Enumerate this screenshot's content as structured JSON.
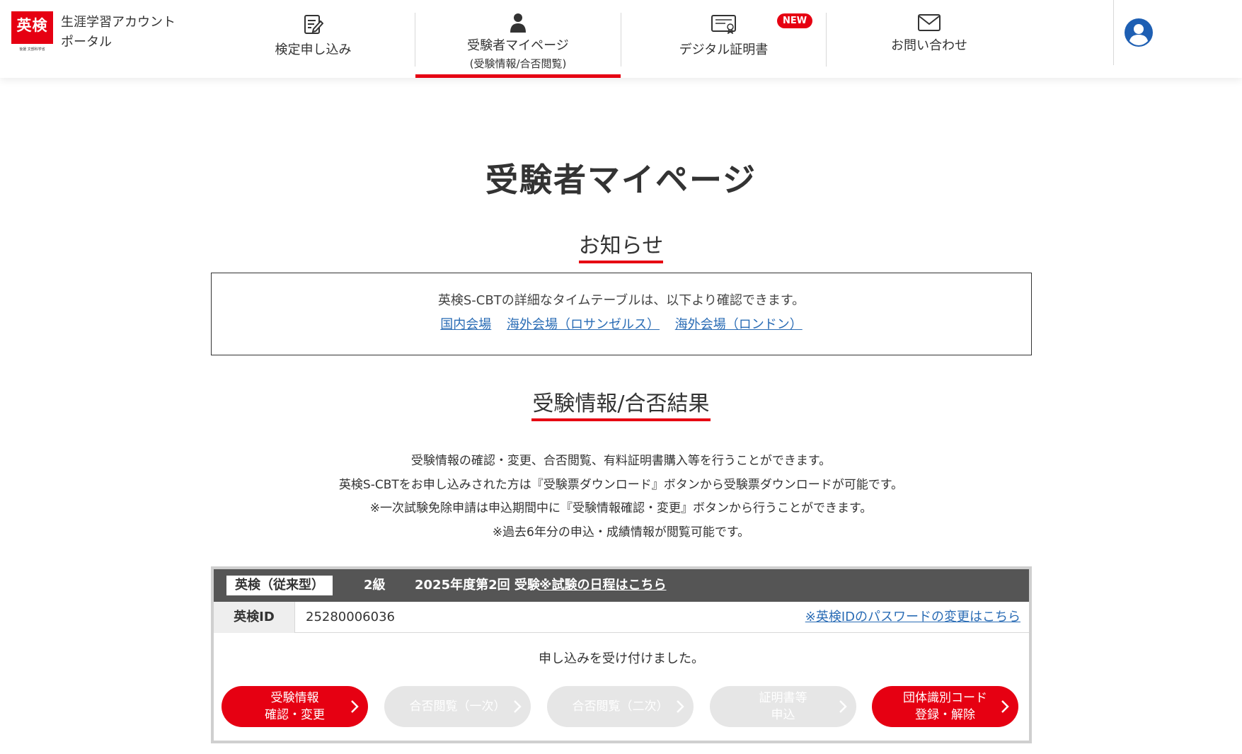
{
  "header": {
    "logo_text": "英検",
    "logo_sub": "後援 文部科学省",
    "portal_line1": "生涯学習アカウント",
    "portal_line2": "ポータル",
    "nav": [
      {
        "label": "検定申し込み",
        "icon": "form-edit-icon"
      },
      {
        "label": "受験者マイページ",
        "sub": "(受験情報/合否閲覧)",
        "icon": "person-icon",
        "active": true
      },
      {
        "label": "デジタル証明書",
        "icon": "certificate-icon",
        "badge": "NEW"
      },
      {
        "label": "お問い合わせ",
        "icon": "mail-icon"
      }
    ],
    "user_icon": "user-account-icon"
  },
  "main": {
    "page_title": "受験者マイページ",
    "notice": {
      "title": "お知らせ",
      "text": "英検S-CBTの詳細なタイムテーブルは、以下より確認できます。",
      "links": [
        "国内会場",
        "海外会場（ロサンゼルス）",
        "海外会場（ロンドン）"
      ]
    },
    "results": {
      "title": "受験情報/合否結果",
      "desc": [
        "受験情報の確認・変更、合否閲覧、有料証明書購入等を行うことができます。",
        "英検S-CBTをお申し込みされた方は『受験票ダウンロード』ボタンから受験票ダウンロードが可能です。",
        "※一次試験免除申請は申込期間中に『受験情報確認・変更』ボタンから行うことができます。",
        "※過去6年分の申込・成績情報が閲覧可能です。"
      ]
    },
    "exam_card": {
      "exam_type": "英検（従来型）",
      "grade": "2級",
      "session": "2025年度第2回 受験",
      "schedule_link": "※試験の日程はこちら",
      "id_label": "英検ID",
      "id_value": "25280006036",
      "password_link": "※英検IDのパスワードの変更はこちら",
      "status": "申し込みを受け付けました。",
      "buttons": [
        {
          "line1": "受験情報",
          "line2": "確認・変更",
          "enabled": true
        },
        {
          "line1": "合否閲覧（一次）",
          "line2": "",
          "enabled": false
        },
        {
          "line1": "合否閲覧（二次）",
          "line2": "",
          "enabled": false
        },
        {
          "line1": "証明書等",
          "line2": "申込",
          "enabled": false
        },
        {
          "line1": "団体識別コード",
          "line2": "登録・解除",
          "enabled": true
        }
      ]
    }
  },
  "colors": {
    "brand_red": "#e60012",
    "link_blue": "#2a6cb5",
    "card_head": "#555555",
    "disabled_button": "#e6e6e6"
  }
}
